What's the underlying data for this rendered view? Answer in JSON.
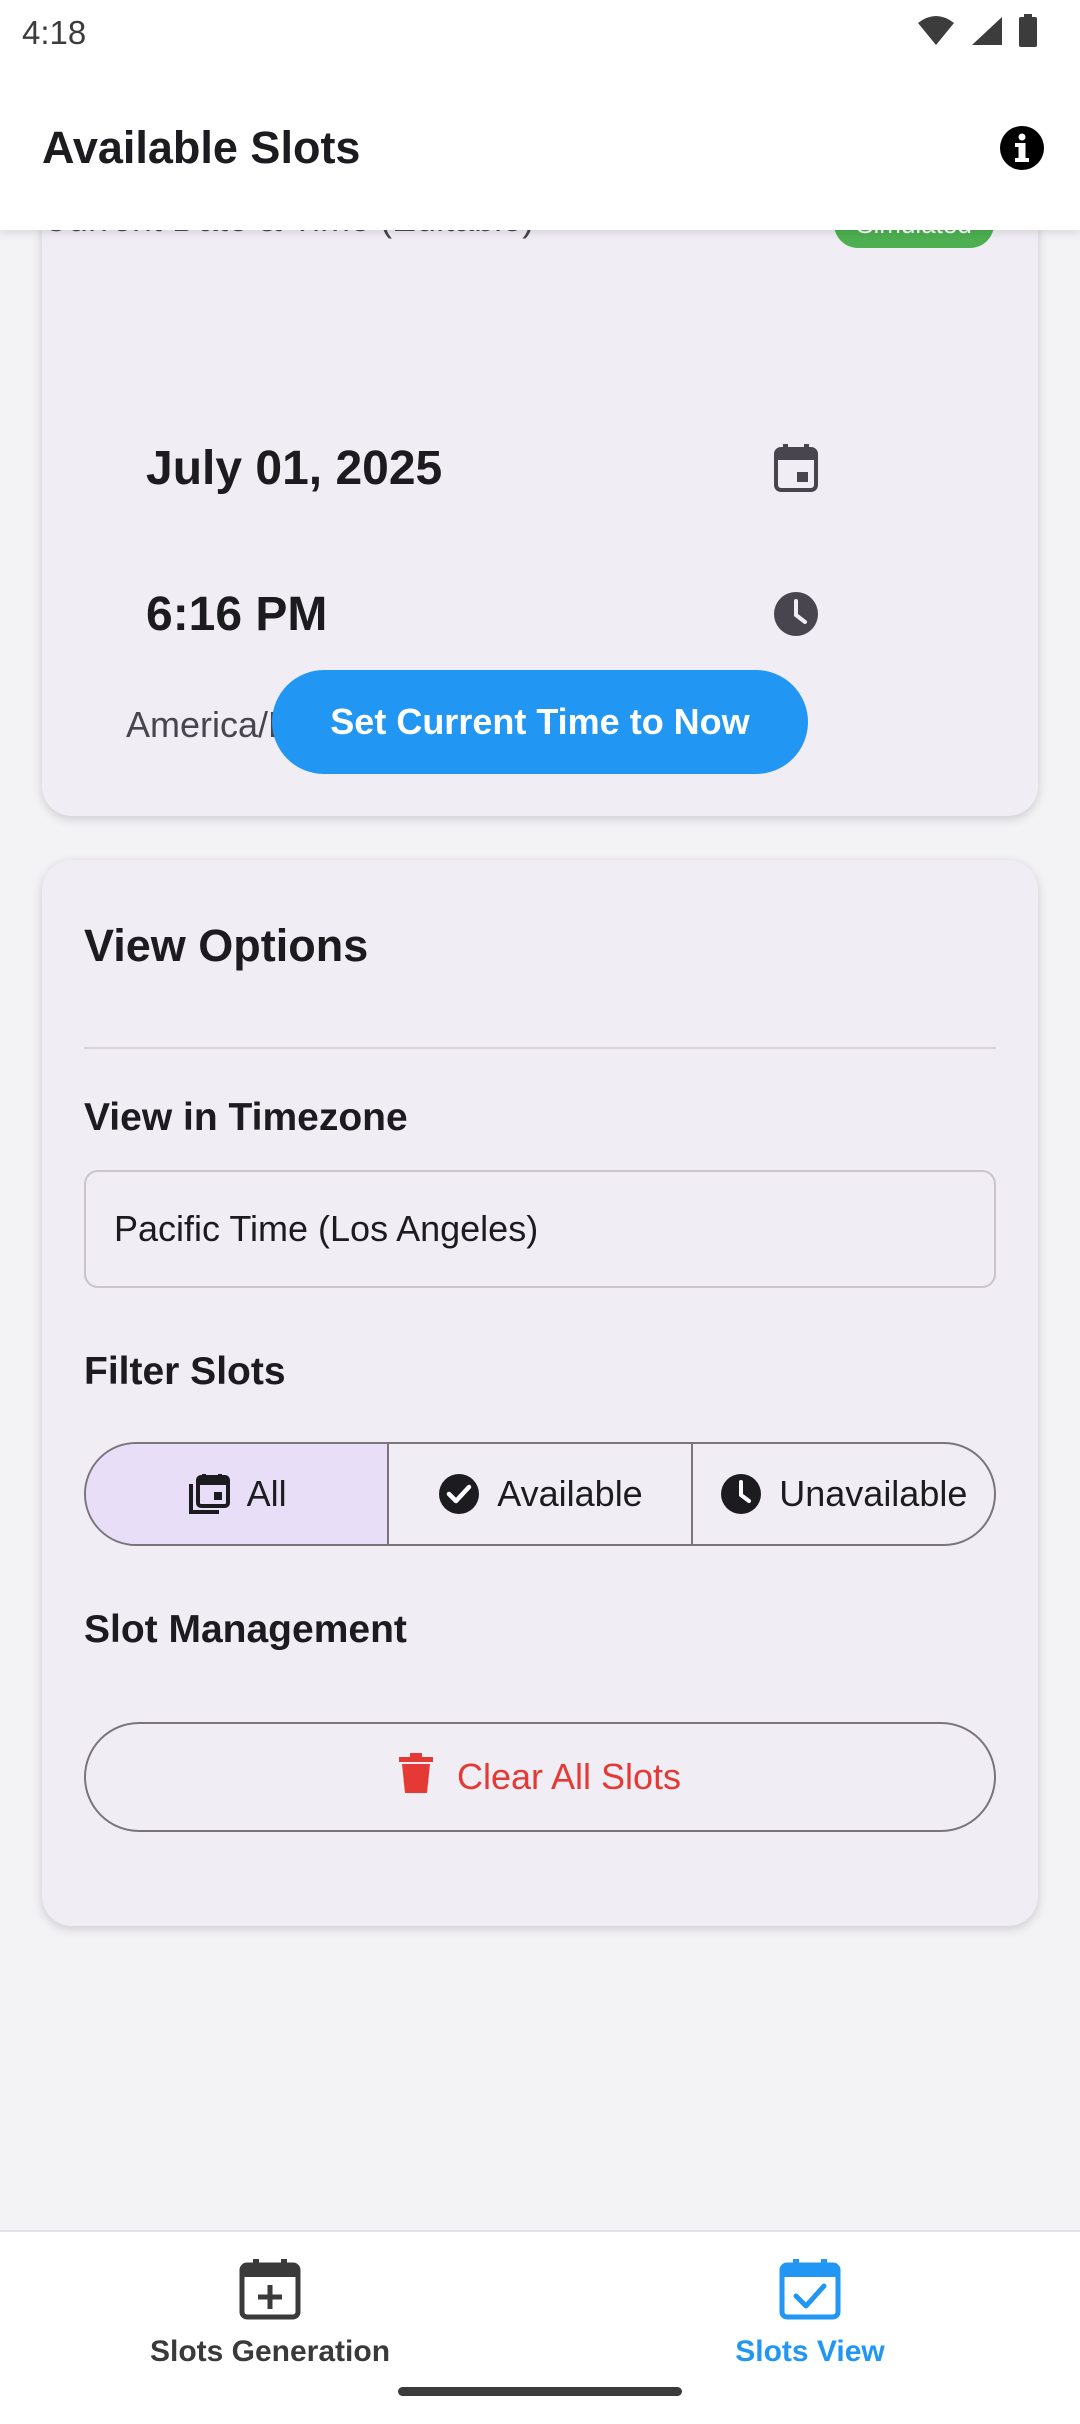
{
  "status_bar": {
    "time": "4:18"
  },
  "app_bar": {
    "title": "Available Slots",
    "info_icon": "info-icon"
  },
  "current_datetime_card": {
    "label": "Current Date & Time (Editable)",
    "badge": "Simulated",
    "date_value": "July 01, 2025",
    "time_value": "6:16 PM",
    "timezone": "America/Los_Angeles",
    "now_button_label": "Set Current Time to Now"
  },
  "view_options": {
    "title": "View Options",
    "timezone_label": "View in Timezone",
    "timezone_value": "Pacific Time (Los Angeles)",
    "filter_label": "Filter Slots",
    "filters": [
      {
        "label": "All",
        "icon": "calendar-stack-icon",
        "selected": true
      },
      {
        "label": "Available",
        "icon": "check-circle-icon",
        "selected": false
      },
      {
        "label": "Unavailable",
        "icon": "clock-icon",
        "selected": false
      }
    ],
    "management_label": "Slot Management",
    "clear_button_label": "Clear All Slots"
  },
  "bottom_nav": {
    "items": [
      {
        "label": "Slots Generation",
        "icon": "calendar-add-icon",
        "active": false
      },
      {
        "label": "Slots View",
        "icon": "calendar-check-icon",
        "active": true
      }
    ]
  },
  "colors": {
    "primary": "#2196f3",
    "danger": "#e53935",
    "badge": "#4caf50",
    "card_bg": "#f0edf4",
    "selected_segment": "#e8def8"
  }
}
